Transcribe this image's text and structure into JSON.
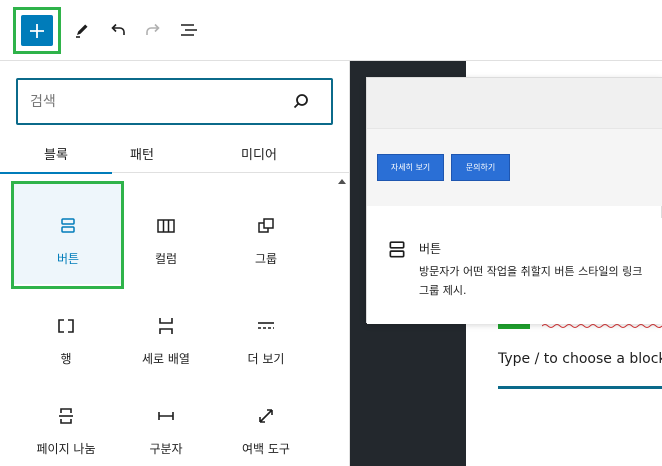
{
  "toolbar": {
    "add_icon": "plus-icon",
    "tools_icon": "pencil-icon",
    "undo_icon": "undo-icon",
    "redo_icon": "redo-icon",
    "outline_icon": "list-view-icon",
    "colors": {
      "primary": "#007cba",
      "highlight": "#2fb34a"
    }
  },
  "inserter": {
    "search": {
      "placeholder": "검색",
      "icon": "search-icon"
    },
    "tabs": [
      {
        "label": "블록",
        "active": true
      },
      {
        "label": "패턴",
        "active": false
      },
      {
        "label": "미디어",
        "active": false
      }
    ],
    "blocks": [
      {
        "label": "버튼",
        "icon": "buttons-icon",
        "selected": true
      },
      {
        "label": "컬럼",
        "icon": "columns-icon",
        "selected": false
      },
      {
        "label": "그룹",
        "icon": "group-icon",
        "selected": false
      },
      {
        "label": "행",
        "icon": "row-icon",
        "selected": false
      },
      {
        "label": "세로 배열",
        "icon": "stack-icon",
        "selected": false
      },
      {
        "label": "더 보기",
        "icon": "more-icon",
        "selected": false
      },
      {
        "label": "페이지 나눔",
        "icon": "page-break-icon",
        "selected": false
      },
      {
        "label": "구분자",
        "icon": "separator-icon",
        "selected": false
      },
      {
        "label": "여백 도구",
        "icon": "spacer-icon",
        "selected": false
      }
    ]
  },
  "preview": {
    "buttons": [
      "자세히 보기",
      "문의하기"
    ],
    "title": "버튼",
    "description": "방문자가 어떤 작업을 취할지 버튼 스타일의 링크 그룹 제시.",
    "button_color": "#2a6fd6"
  },
  "editor": {
    "placeholder": "Type / to choose a block"
  }
}
